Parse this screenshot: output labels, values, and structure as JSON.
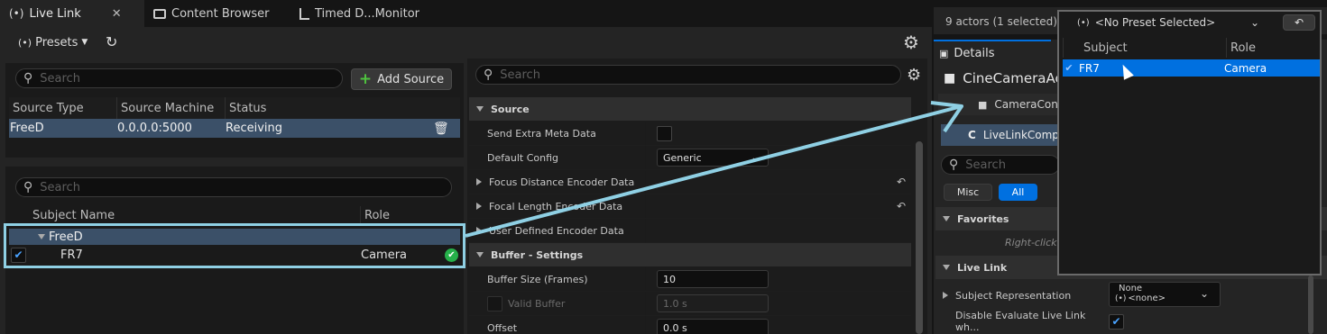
{
  "tabs": [
    {
      "label": "Live Link",
      "close": "✕"
    },
    {
      "label": "Content Browser"
    },
    {
      "label": "Timed D...Monitor"
    }
  ],
  "toolbar": {
    "presets_label": "Presets"
  },
  "sources": {
    "search_placeholder": "Search",
    "add_source_label": "Add Source",
    "columns": [
      "Source Type",
      "Source Machine",
      "Status"
    ],
    "rows": [
      {
        "type": "FreeD",
        "machine": "0.0.0.0:5000",
        "status": "Receiving"
      }
    ]
  },
  "subjects": {
    "search_placeholder": "Search",
    "columns": [
      "Subject Name",
      "Role"
    ],
    "group": "FreeD",
    "items": [
      {
        "name": "FR7",
        "role": "Camera"
      }
    ]
  },
  "source_details": {
    "search_placeholder": "Search",
    "sections": {
      "source": "Source",
      "buffer": "Buffer - Settings"
    },
    "props": {
      "send_extra": "Send Extra Meta Data",
      "default_config": "Default Config",
      "default_config_value": "Generic",
      "focus_distance": "Focus Distance Encoder Data",
      "focal_length": "Focal Length Encoder Data",
      "user_defined": "User Defined Encoder Data",
      "buffer_size": "Buffer Size (Frames)",
      "buffer_size_value": "10",
      "valid_buffer": "Valid Buffer",
      "valid_buffer_value": "1.0 s",
      "offset": "Offset",
      "offset_value": "0.0 s"
    }
  },
  "outliner": {
    "actor_count": "9 actors (1 selected)"
  },
  "details": {
    "tab_label": "Details",
    "actor_name": "CineCameraAc",
    "component1": "CameraCon",
    "component2": "LiveLinkComp",
    "search_placeholder": "Search",
    "filter_misc": "Misc",
    "filter_all": "All",
    "favorites_section": "Favorites",
    "favorites_hint": "Right-click",
    "livelink_section": "Live Link",
    "subject_rep": "Subject Representation",
    "subject_rep_value_top": "None",
    "subject_rep_value_bottom": "<none>",
    "disable_eval": "Disable Evaluate Live Link wh..."
  },
  "preset_popup": {
    "combo_label": "<No Preset Selected>",
    "columns": [
      "Subject",
      "Role"
    ],
    "rows": [
      {
        "subject": "FR7",
        "role": "Camera"
      }
    ]
  },
  "colors": {
    "accent": "#0070e0",
    "highlight": "#8fd0e4",
    "ok": "#26b04a"
  }
}
